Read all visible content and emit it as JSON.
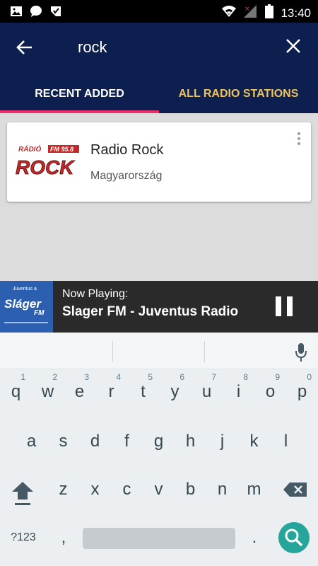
{
  "status_bar": {
    "time": "13:40",
    "icons": [
      "gallery-icon",
      "chat-icon",
      "task-icon",
      "wifi-icon",
      "signal-icon",
      "battery-icon"
    ]
  },
  "app_bar": {
    "search_query": "rock",
    "tabs": [
      {
        "label": "RECENT ADDED",
        "active": true
      },
      {
        "label": "ALL RADIO STATIONS",
        "active": false
      }
    ],
    "colors": {
      "background": "#0c1f4e",
      "indicator": "#e8326b",
      "inactive_tab": "#f0c35a"
    }
  },
  "results": [
    {
      "title": "Radio Rock",
      "subtitle": "Magyarország",
      "logo": {
        "top_text": "RÁDIÓ",
        "badge": "FM 95.8",
        "main_text": "ROCK"
      }
    }
  ],
  "now_playing": {
    "label": "Now Playing:",
    "title": "Slager FM - Juventus Radio",
    "thumb": {
      "top_text": "Juventus a",
      "main_text": "Sláger",
      "sub_text": "FM"
    }
  },
  "keyboard": {
    "row1": [
      {
        "k": "q",
        "h": "1"
      },
      {
        "k": "w",
        "h": "2"
      },
      {
        "k": "e",
        "h": "3"
      },
      {
        "k": "r",
        "h": "4"
      },
      {
        "k": "t",
        "h": "5"
      },
      {
        "k": "y",
        "h": "6"
      },
      {
        "k": "u",
        "h": "7"
      },
      {
        "k": "i",
        "h": "8"
      },
      {
        "k": "o",
        "h": "9"
      },
      {
        "k": "p",
        "h": "0"
      }
    ],
    "row2": [
      "a",
      "s",
      "d",
      "f",
      "g",
      "h",
      "j",
      "k",
      "l"
    ],
    "row3": [
      "z",
      "x",
      "c",
      "v",
      "b",
      "n",
      "m"
    ],
    "symbols_label": "?123",
    "comma": ",",
    "period": "."
  }
}
